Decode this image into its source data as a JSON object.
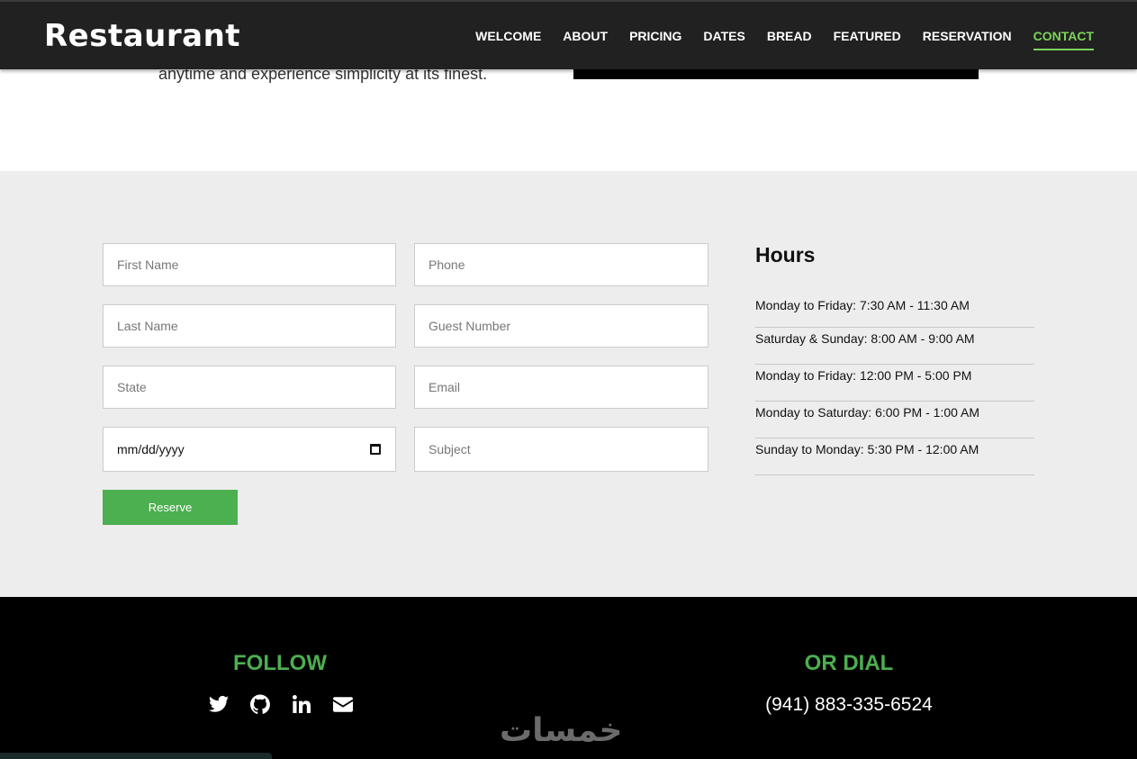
{
  "brand": "Restaurant",
  "nav": {
    "items": [
      {
        "label": "WELCOME"
      },
      {
        "label": "ABOUT"
      },
      {
        "label": "PRICING"
      },
      {
        "label": "DATES"
      },
      {
        "label": "BREAD"
      },
      {
        "label": "FEATURED"
      },
      {
        "label": "RESERVATION"
      },
      {
        "label": "CONTACT",
        "active": true
      }
    ]
  },
  "hero": {
    "text": "anytime and experience simplicity at its finest."
  },
  "form": {
    "first_name_placeholder": "First Name",
    "phone_placeholder": "Phone",
    "last_name_placeholder": "Last Name",
    "guest_number_placeholder": "Guest Number",
    "state_placeholder": "State",
    "email_placeholder": "Email",
    "date_value": "mm/dd/yyyy",
    "subject_placeholder": "Subject",
    "reserve_label": "Reserve"
  },
  "hours": {
    "title": "Hours",
    "items": [
      "Monday to Friday: 7:30 AM - 11:30 AM",
      "Saturday & Sunday: 8:00 AM - 9:00 AM",
      "Monday to Friday: 12:00 PM - 5:00 PM",
      "Monday to Saturday: 6:00 PM - 1:00 AM",
      "Sunday to Monday: 5:30 PM - 12:00 AM"
    ]
  },
  "footer": {
    "follow_title": "FOLLOW",
    "social_icons": [
      "twitter-icon",
      "github-icon",
      "linkedin-icon",
      "email-icon"
    ],
    "dial_title": "OR DIAL",
    "phone": "(941) 883-335-6524",
    "watermark": "خمسات"
  },
  "colors": {
    "accent": "#4caf50",
    "nav_active": "#7dd35a",
    "navbar_bg": "#212121",
    "section_bg": "#ededed",
    "footer_bg": "#000000"
  }
}
